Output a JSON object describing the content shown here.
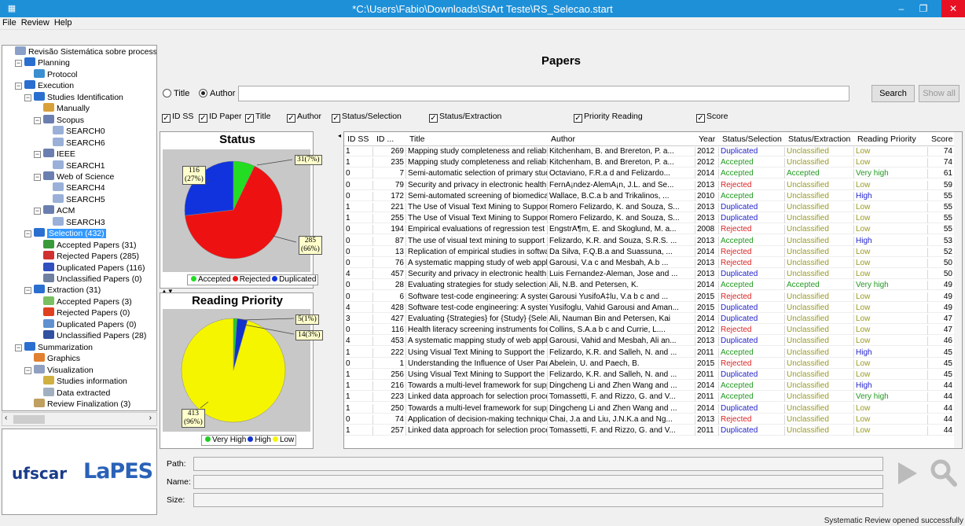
{
  "window": {
    "title": "*C:\\Users\\Fabio\\Downloads\\StArt Teste\\RS_Selecao.start",
    "min": "–",
    "max": "❐",
    "close": "✕",
    "app_icon": "grid-icon"
  },
  "menu": [
    "File",
    "Review",
    "Help"
  ],
  "tree": [
    {
      "label": "Revisão Sistemática sobre processos e",
      "icon": "review-icon",
      "color": "#8aa0c8"
    },
    {
      "label": "Planning",
      "icon": "folder-icon",
      "color": "#2a6fd0"
    },
    {
      "label": "Protocol",
      "icon": "protocol-icon",
      "color": "#3a8fd0"
    },
    {
      "label": "Execution",
      "icon": "folder-icon",
      "color": "#2a6fd0"
    },
    {
      "label": "Studies Identification",
      "icon": "folder-icon",
      "color": "#2a6fd0"
    },
    {
      "label": "Manually",
      "icon": "people-icon",
      "color": "#d9a03a"
    },
    {
      "label": "Scopus",
      "icon": "search-db-icon",
      "color": "#6a7fb0"
    },
    {
      "label": "SEARCH0",
      "icon": "doc-icon",
      "color": "#9ab0d8"
    },
    {
      "label": "SEARCH6",
      "icon": "doc-icon",
      "color": "#9ab0d8"
    },
    {
      "label": "IEEE",
      "icon": "search-db-icon",
      "color": "#6a7fb0"
    },
    {
      "label": "SEARCH1",
      "icon": "doc-icon",
      "color": "#9ab0d8"
    },
    {
      "label": "Web of Science",
      "icon": "search-db-icon",
      "color": "#6a7fb0"
    },
    {
      "label": "SEARCH4",
      "icon": "doc-icon",
      "color": "#9ab0d8"
    },
    {
      "label": "SEARCH5",
      "icon": "doc-icon",
      "color": "#9ab0d8"
    },
    {
      "label": "ACM",
      "icon": "search-db-icon",
      "color": "#6a7fb0"
    },
    {
      "label": "SEARCH3",
      "icon": "doc-icon",
      "color": "#9ab0d8"
    },
    {
      "label": "Selection (432)",
      "icon": "folder-icon",
      "color": "#2a6fd0"
    },
    {
      "label": "Accepted Papers (31)",
      "icon": "accepted-icon",
      "color": "#3a9a3a"
    },
    {
      "label": "Rejected Papers (285)",
      "icon": "rejected-icon",
      "color": "#d03030"
    },
    {
      "label": "Duplicated Papers (116)",
      "icon": "duplicated-icon",
      "color": "#3050c0"
    },
    {
      "label": "Unclassified Papers (0)",
      "icon": "unclassified-icon",
      "color": "#7080a0"
    },
    {
      "label": "Extraction (31)",
      "icon": "folder-icon",
      "color": "#2a6fd0"
    },
    {
      "label": "Accepted Papers (3)",
      "icon": "check-icon",
      "color": "#7ac060"
    },
    {
      "label": "Rejected Papers (0)",
      "icon": "x-icon",
      "color": "#e04020"
    },
    {
      "label": "Duplicated Papers (0)",
      "icon": "duplicated-icon",
      "color": "#6090d0"
    },
    {
      "label": "Unclassified Papers (28)",
      "icon": "question-icon",
      "color": "#3050a0"
    },
    {
      "label": "Summarization",
      "icon": "folder-icon",
      "color": "#2a6fd0"
    },
    {
      "label": "Graphics",
      "icon": "pie-icon",
      "color": "#e08030"
    },
    {
      "label": "Visualization",
      "icon": "list-icon",
      "color": "#90a0c0"
    },
    {
      "label": "Studies information",
      "icon": "info-icon",
      "color": "#d0b040"
    },
    {
      "label": "Data extracted",
      "icon": "data-icon",
      "color": "#a0b0c0"
    },
    {
      "label": "Review Finalization (3)",
      "icon": "finalize-icon",
      "color": "#c0a060"
    }
  ],
  "logos": {
    "ufscar": "ufscar",
    "lapes": "LaPES"
  },
  "header": {
    "title": "Papers"
  },
  "search": {
    "opt_title": "Title",
    "opt_author": "Author",
    "value": "",
    "search_btn": "Search",
    "showall_btn": "Show all"
  },
  "columns_toggle": [
    "ID SS",
    "ID Paper",
    "Title",
    "Author",
    "Status/Selection",
    "Status/Extraction",
    "Priority Reading",
    "Score"
  ],
  "chart_data": [
    {
      "type": "pie",
      "title": "Status",
      "series": [
        {
          "name": "Accepted",
          "value": 31,
          "label": "31(7%)",
          "color": "#22dd22"
        },
        {
          "name": "Rejected",
          "value": 285,
          "label": "285\n(66%)",
          "color": "#ee1111"
        },
        {
          "name": "Duplicated",
          "value": 116,
          "label": "116\n(27%)",
          "color": "#1133dd"
        }
      ],
      "legend": [
        "Accepted",
        "Rejected",
        "Duplicated"
      ]
    },
    {
      "type": "pie",
      "title": "Reading Priority",
      "series": [
        {
          "name": "Very High",
          "value": 5,
          "label": "5(1%)",
          "color": "#22cc22"
        },
        {
          "name": "High",
          "value": 14,
          "label": "14(3%)",
          "color": "#1133cc"
        },
        {
          "name": "Low",
          "value": 413,
          "label": "413\n(96%)",
          "color": "#f5f500"
        }
      ],
      "legend": [
        "Very High",
        "High",
        "Low"
      ]
    }
  ],
  "table": {
    "headers": [
      "ID SS",
      "ID ...",
      "Title",
      "Author",
      "Year",
      "Status/Selection",
      "Status/Extraction",
      "Reading Priority",
      "Score"
    ],
    "status_colors": {
      "Duplicated": "#2222cc",
      "Accepted": "#229922",
      "Rejected": "#dd2222",
      "Unclassified": "#999922",
      "Low": "#999922",
      "High": "#2222cc",
      "Very high": "#229922"
    },
    "rows": [
      [
        "1",
        "269",
        "Mapping study completeness and reliability - ...",
        "Kitchenham, B. and Brereton, P. a...",
        "2012",
        "Duplicated",
        "Unclassified",
        "Low",
        "74"
      ],
      [
        "1",
        "235",
        "Mapping study completeness and reliability - ...",
        "Kitchenham, B. and Brereton, P. a...",
        "2012",
        "Accepted",
        "Unclassified",
        "Low",
        "74"
      ],
      [
        "0",
        "7",
        "Semi-automatic selection of primary studies i...",
        "Octaviano, F.R.a d and Felizardo...",
        "2014",
        "Accepted",
        "Accepted",
        "Very high",
        "61"
      ],
      [
        "0",
        "79",
        "Security and privacy in electronic health reco...",
        "FernÃ¡ndez-AlemÃ¡n, J.L. and Se...",
        "2013",
        "Rejected",
        "Unclassified",
        "Low",
        "59"
      ],
      [
        "0",
        "172",
        "Semi-automated screening of biomedical cita...",
        "Wallace, B.C.a b and Trikalinos, ...",
        "2010",
        "Accepted",
        "Unclassified",
        "High",
        "55"
      ],
      [
        "1",
        "221",
        "The Use of Visual Text Mining to Support the...",
        "Romero Felizardo, K. and Souza, S...",
        "2013",
        "Duplicated",
        "Unclassified",
        "Low",
        "55"
      ],
      [
        "1",
        "255",
        "The Use of Visual Text Mining to Support the...",
        "Romero Felizardo, K. and Souza, S...",
        "2013",
        "Duplicated",
        "Unclassified",
        "Low",
        "55"
      ],
      [
        "0",
        "194",
        "Empirical evaluations of regression test selec...",
        "EngstrÃ¶m, E. and Skoglund, M. a...",
        "2008",
        "Rejected",
        "Unclassified",
        "Low",
        "55"
      ],
      [
        "0",
        "87",
        "The use of visual text mining to support the ...",
        "Felizardo, K.R. and Souza, S.R.S. ...",
        "2013",
        "Accepted",
        "Unclassified",
        "High",
        "53"
      ],
      [
        "0",
        "13",
        "Replication of empirical studies in software e...",
        "Da Silva, F.Q.B.a and Suassuna, ...",
        "2014",
        "Rejected",
        "Unclassified",
        "Low",
        "52"
      ],
      [
        "0",
        "76",
        "A systematic mapping study of web applicati...",
        "Garousi, V.a c and Mesbah, A.b ...",
        "2013",
        "Rejected",
        "Unclassified",
        "Low",
        "50"
      ],
      [
        "4",
        "457",
        "Security and privacy in electronic health reco...",
        "Luis Fernandez-Aleman, Jose and ...",
        "2013",
        "Duplicated",
        "Unclassified",
        "Low",
        "50"
      ],
      [
        "0",
        "28",
        "Evaluating strategies for study selection in s...",
        "Ali, N.B. and Petersen, K.",
        "2014",
        "Accepted",
        "Accepted",
        "Very high",
        "49"
      ],
      [
        "0",
        "6",
        "Software test-code engineering: A systemati...",
        "Garousi YusifoÄ‡lu, V.a b c and ...",
        "2015",
        "Rejected",
        "Unclassified",
        "Low",
        "49"
      ],
      [
        "4",
        "428",
        "Software test-code engineering: A systemati...",
        "Yusifoglu, Vahid Garousi and Aman...",
        "2015",
        "Duplicated",
        "Unclassified",
        "Low",
        "49"
      ],
      [
        "3",
        "427",
        "Evaluating {Strategies} for {Study} {Selectio...",
        "Ali, Nauman Bin and Petersen, Kai",
        "2014",
        "Duplicated",
        "Unclassified",
        "Low",
        "47"
      ],
      [
        "0",
        "116",
        "Health literacy screening instruments for eH...",
        "Collins, S.A.a b c and Currie, L....",
        "2012",
        "Rejected",
        "Unclassified",
        "Low",
        "47"
      ],
      [
        "4",
        "453",
        "A systematic mapping study of web applicati...",
        "Garousi, Vahid and Mesbah, Ali an...",
        "2013",
        "Duplicated",
        "Unclassified",
        "Low",
        "46"
      ],
      [
        "1",
        "222",
        "Using Visual Text Mining to Support the Stud...",
        "Felizardo, K.R. and Salleh, N. and ...",
        "2011",
        "Accepted",
        "Unclassified",
        "High",
        "45"
      ],
      [
        "0",
        "1",
        "Understanding the Influence of User Particip...",
        "Abelein, U. and Paech, B.",
        "2015",
        "Rejected",
        "Unclassified",
        "Low",
        "45"
      ],
      [
        "1",
        "256",
        "Using Visual Text Mining to Support the Stud...",
        "Felizardo, K.R. and Salleh, N. and ...",
        "2011",
        "Duplicated",
        "Unclassified",
        "Low",
        "45"
      ],
      [
        "1",
        "216",
        "Towards a multi-level framework for supporti...",
        "Dingcheng Li and Zhen Wang and ...",
        "2014",
        "Accepted",
        "Unclassified",
        "High",
        "44"
      ],
      [
        "1",
        "223",
        "Linked data approach for selection process a...",
        "Tomassetti, F. and Rizzo, G. and V...",
        "2011",
        "Accepted",
        "Unclassified",
        "Very high",
        "44"
      ],
      [
        "1",
        "250",
        "Towards a multi-level framework for supporti...",
        "Dingcheng Li and Zhen Wang and ...",
        "2014",
        "Duplicated",
        "Unclassified",
        "Low",
        "44"
      ],
      [
        "0",
        "74",
        "Application of decision-making techniques in ...",
        "Chai, J.a and Liu, J.N.K.a and Ng...",
        "2013",
        "Rejected",
        "Unclassified",
        "Low",
        "44"
      ],
      [
        "1",
        "257",
        "Linked data approach for selection process a...",
        "Tomassetti, F. and Rizzo, G. and V...",
        "2011",
        "Duplicated",
        "Unclassified",
        "Low",
        "44"
      ]
    ]
  },
  "bottom": {
    "path": "Path:",
    "name": "Name:",
    "size": "Size:",
    "play_icon": "play-icon",
    "search_icon": "magnifier-icon"
  },
  "status": "Systematic Review opened successfully"
}
